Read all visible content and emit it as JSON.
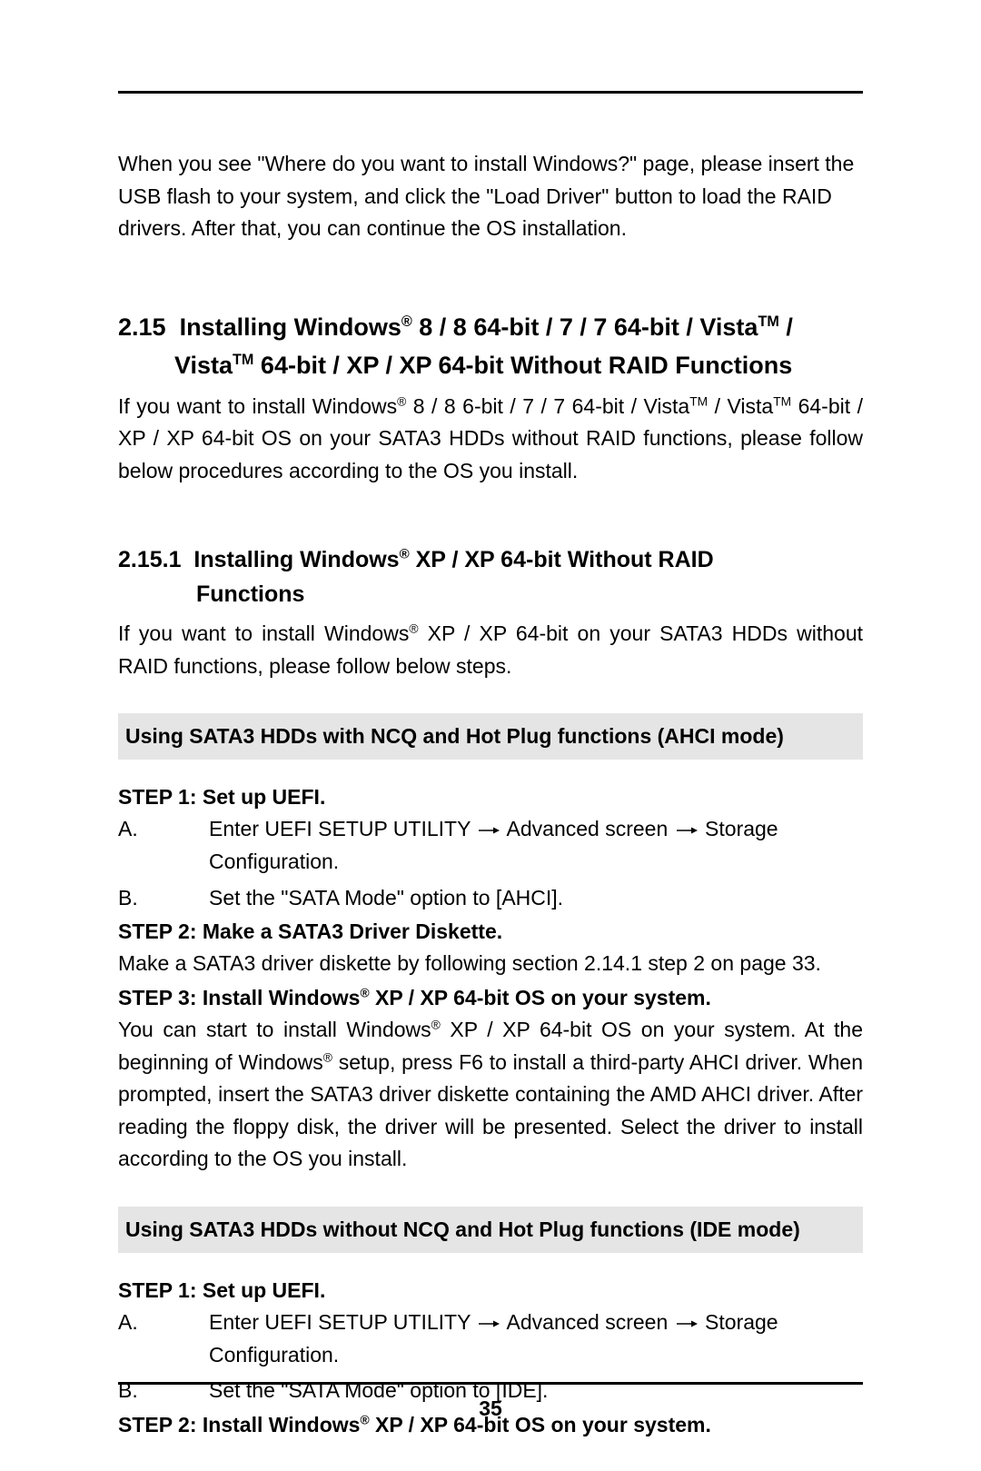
{
  "intro_paragraph": "When you see \"Where do you want to install Windows?\" page, please insert the USB flash to your system, and click the \"Load Driver\" button to load the RAID drivers. After that, you can continue the OS installation.",
  "section_215": {
    "number": "2.15",
    "title_line1_before": "Installing Windows",
    "reg1": "®",
    "title_line1_mid": " 8 / 8 64-bit / 7 / 7 64-bit / Vista",
    "tm1": "TM",
    "title_line1_end": " /",
    "title_line2_before": "Vista",
    "tm2": "TM",
    "title_line2_end": " 64-bit / XP / XP 64-bit Without RAID Functions",
    "body_1a": "If you want to install Windows",
    "body_1a_reg": "®",
    "body_1b": " 8 / 8 6-bit / 7 / 7 64-bit / Vista",
    "body_1b_tm": "TM",
    "body_1c": " / Vista",
    "body_1c_tm": "TM",
    "body_1d": " 64-bit / XP / XP 64-bit OS on your SATA3 HDDs without RAID functions, please follow below procedures according to the OS you install."
  },
  "section_2151": {
    "number": "2.15.1",
    "title_line1_before": "Installing Windows",
    "reg": "®",
    "title_line1_after": " XP / XP 64-bit Without RAID",
    "title_line2": "Functions",
    "body_a": "If you want to install Windows",
    "body_a_reg": "®",
    "body_b": " XP / XP 64-bit on your SATA3 HDDs without RAID functions, please follow below steps."
  },
  "ahci_band": "Using SATA3 HDDs with NCQ and Hot Plug functions (AHCI mode)",
  "ahci": {
    "step1_title": "STEP 1: Set up UEFI.",
    "a_label": "A.",
    "a_part1": "Enter UEFI SETUP UTILITY",
    "a_part2": "Advanced screen",
    "a_part3": "Storage Configuration.",
    "b_label": "B.",
    "b_text": "Set the \"SATA Mode\" option to [AHCI].",
    "step2_title": "STEP 2: Make a SATA3 Driver Diskette.",
    "step2_body": "Make a SATA3 driver diskette by following section 2.14.1 step 2 on page 33.",
    "step3_title_a": "STEP 3: Install Windows",
    "step3_title_reg": "®",
    "step3_title_b": " XP / XP 64-bit OS on your system.",
    "step3_body_a": "You can start to install Windows",
    "step3_body_reg1": "®",
    "step3_body_b": " XP / XP 64-bit OS on your system. At the beginning of Windows",
    "step3_body_reg2": "®",
    "step3_body_c": " setup, press F6 to install a third-party AHCI driver. When prompted, insert the SATA3 driver diskette containing the AMD AHCI driver. After reading the floppy disk, the driver will be presented. Select the driver to install according to the OS you install."
  },
  "ide_band": "Using SATA3 HDDs without NCQ and Hot Plug functions (IDE mode)",
  "ide": {
    "step1_title": "STEP 1: Set up UEFI.",
    "a_label": "A.",
    "a_part1": "Enter UEFI SETUP UTILITY",
    "a_part2": "Advanced screen",
    "a_part3": " Storage Configuration.",
    "b_label": "B.",
    "b_text": "Set the \"SATA Mode\" option to [IDE].",
    "step2_title_a": "STEP 2: Install Windows",
    "step2_title_reg": "®",
    "step2_title_b": " XP / XP 64-bit OS on your system."
  },
  "page_number": "35"
}
